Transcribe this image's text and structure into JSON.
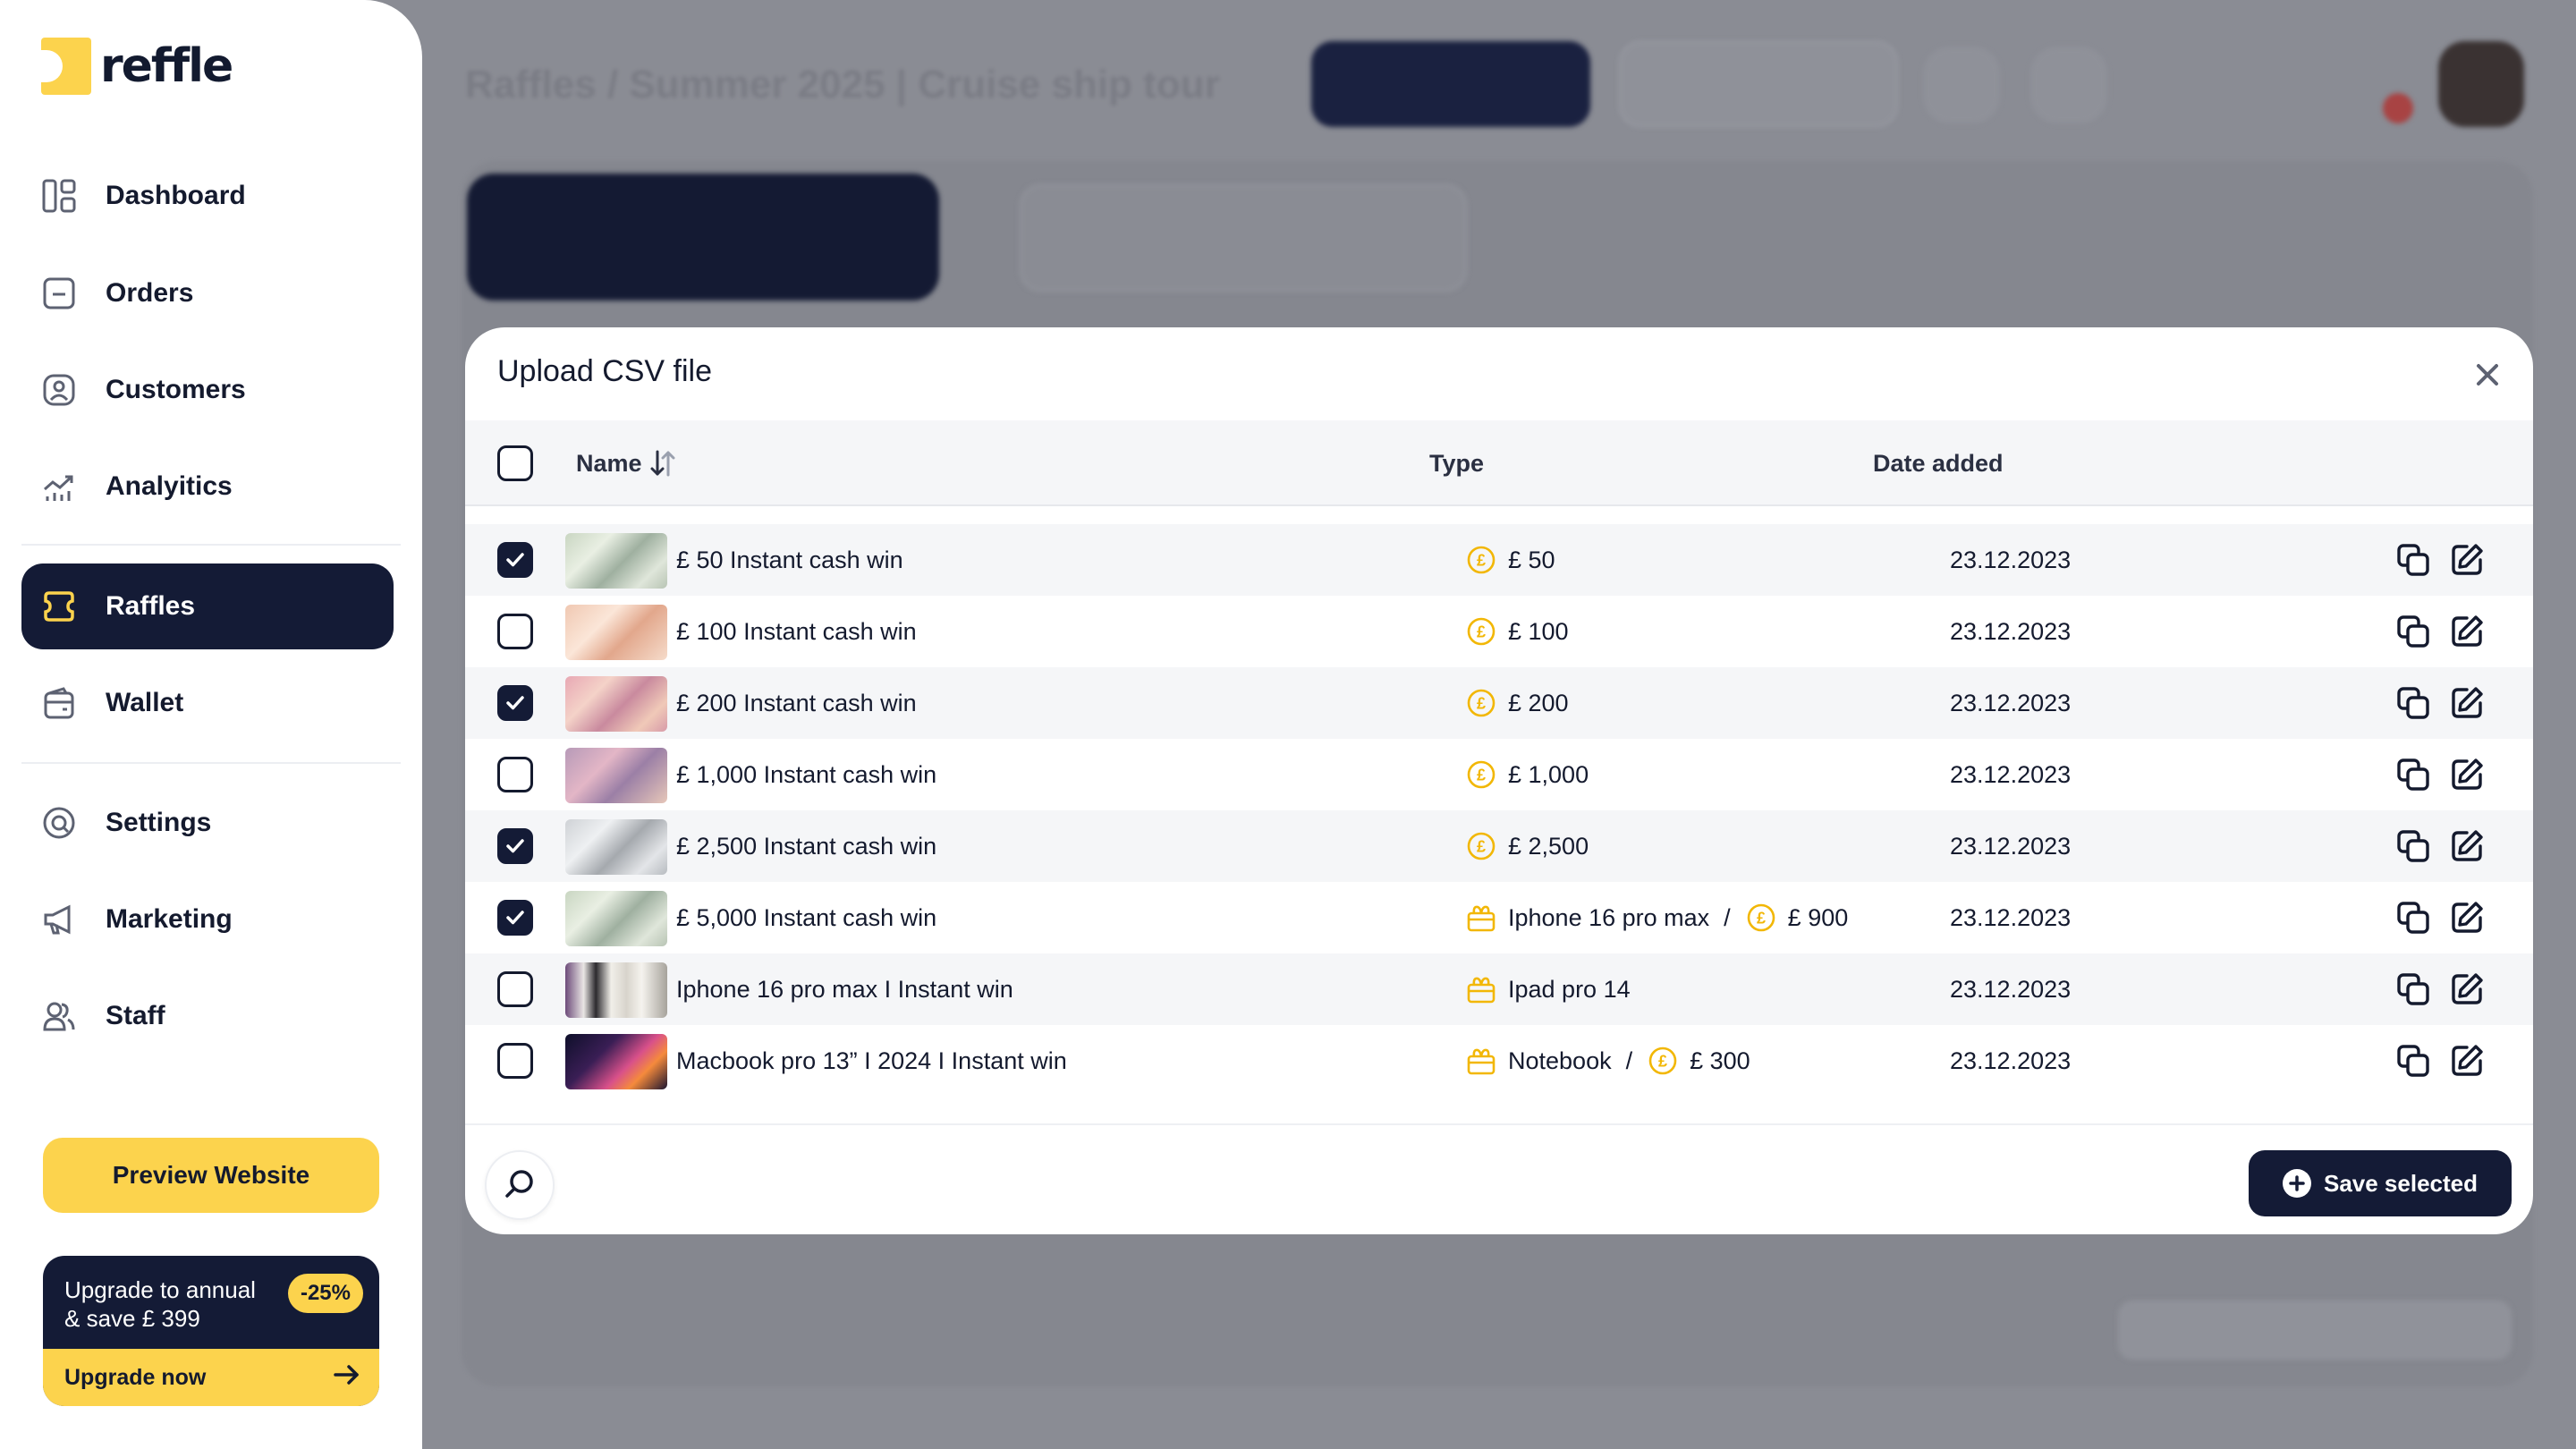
{
  "app": {
    "logo_text": "reffle"
  },
  "sidebar": {
    "items": [
      {
        "label": "Dashboard",
        "icon": "dashboard-icon"
      },
      {
        "label": "Orders",
        "icon": "orders-icon"
      },
      {
        "label": "Customers",
        "icon": "customers-icon"
      },
      {
        "label": "Analyitics",
        "icon": "analytics-icon"
      },
      {
        "label": "Raffles",
        "icon": "ticket-icon",
        "active": true
      },
      {
        "label": "Wallet",
        "icon": "wallet-icon"
      },
      {
        "label": "Settings",
        "icon": "settings-icon"
      },
      {
        "label": "Marketing",
        "icon": "megaphone-icon"
      },
      {
        "label": "Staff",
        "icon": "staff-icon"
      }
    ],
    "preview_label": "Preview Website",
    "upgrade": {
      "text_line1": "Upgrade to annual",
      "text_line2": "& save £ 399",
      "badge": "-25%",
      "cta": "Upgrade now"
    }
  },
  "background": {
    "breadcrumb": "Raffles / Summer 2025 | Cruise ship tour"
  },
  "modal": {
    "title": "Upload CSV file",
    "columns": {
      "name": "Name",
      "type": "Type",
      "date": "Date added"
    },
    "rows": [
      {
        "checked": true,
        "name": "£ 50 Instant cash win",
        "type_parts": [
          {
            "icon": "coin-icon",
            "text": "£ 50"
          }
        ],
        "date": "23.12.2023"
      },
      {
        "checked": false,
        "name": "£ 100 Instant cash win",
        "type_parts": [
          {
            "icon": "coin-icon",
            "text": "£ 100"
          }
        ],
        "date": "23.12.2023"
      },
      {
        "checked": true,
        "name": "£ 200 Instant cash win",
        "type_parts": [
          {
            "icon": "coin-icon",
            "text": "£ 200"
          }
        ],
        "date": "23.12.2023"
      },
      {
        "checked": false,
        "name": "£ 1,000 Instant cash win",
        "type_parts": [
          {
            "icon": "coin-icon",
            "text": "£ 1,000"
          }
        ],
        "date": "23.12.2023"
      },
      {
        "checked": true,
        "name": "£ 2,500 Instant cash win",
        "type_parts": [
          {
            "icon": "coin-icon",
            "text": "£ 2,500"
          }
        ],
        "date": "23.12.2023"
      },
      {
        "checked": true,
        "name": "£ 5,000 Instant cash win",
        "type_parts": [
          {
            "icon": "gift-icon",
            "text": "Iphone 16 pro max"
          },
          {
            "icon": "coin-icon",
            "text": "£ 900"
          }
        ],
        "date": "23.12.2023"
      },
      {
        "checked": false,
        "name": "Iphone 16 pro max I Instant win",
        "type_parts": [
          {
            "icon": "gift-icon",
            "text": "Ipad pro 14"
          }
        ],
        "date": "23.12.2023"
      },
      {
        "checked": false,
        "name": "Macbook pro 13” I 2024 I Instant win",
        "type_parts": [
          {
            "icon": "gift-icon",
            "text": "Notebook"
          },
          {
            "icon": "coin-icon",
            "text": "£ 300"
          }
        ],
        "date": "23.12.2023"
      }
    ],
    "type_separator": "/",
    "save_label": "Save selected"
  },
  "colors": {
    "navy": "#141b36",
    "accent": "#fcd34d",
    "row_alt": "#f5f6f8"
  }
}
